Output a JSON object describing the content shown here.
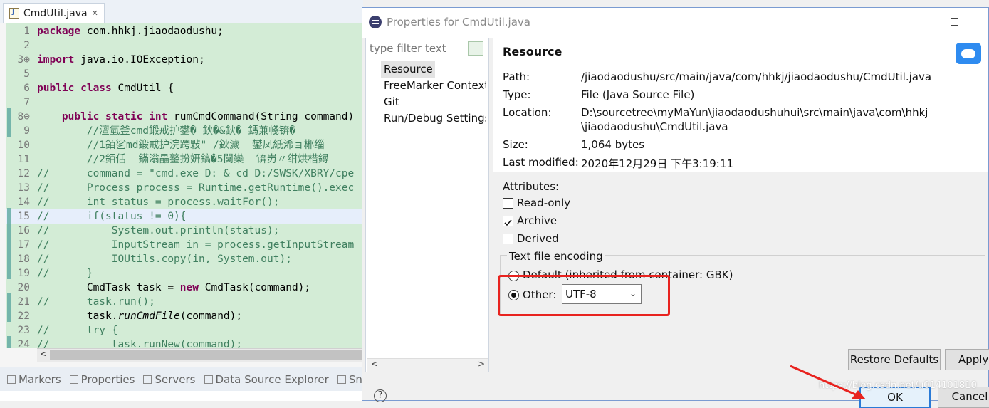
{
  "editor": {
    "tab_label": "CmdUtil.java",
    "tab_close": "✕",
    "lines": [
      {
        "n": "1",
        "marker": "",
        "parts": [
          [
            "kw",
            "package"
          ],
          [
            "",
            "&#32;com.hhkj.jiaodaodushu;"
          ]
        ]
      },
      {
        "n": "2",
        "marker": "",
        "parts": []
      },
      {
        "n": "3",
        "marker": "⊕",
        "parts": [
          [
            "kw",
            "import"
          ],
          [
            "",
            "&#32;java.io.IOException;"
          ]
        ]
      },
      {
        "n": "5",
        "marker": "",
        "parts": []
      },
      {
        "n": "6",
        "marker": "",
        "parts": [
          [
            "kw",
            "public class"
          ],
          [
            "",
            "&#32;CmdUtil {"
          ]
        ]
      },
      {
        "n": "7",
        "marker": "",
        "parts": []
      },
      {
        "n": "8",
        "marker": "⊖",
        "parts": [
          [
            "",
            "    "
          ],
          [
            "kw",
            "public static int"
          ],
          [
            "",
            "&#32;rumCmdCommand(String command)"
          ]
        ]
      },
      {
        "n": "9",
        "marker": "",
        "parts": [
          [
            "cm",
            "        //澶氫釜cmd鍛戒护鐢� 鈥�&鈥� 鎷兼帴锛�"
          ]
        ]
      },
      {
        "n": "10",
        "marker": "",
        "parts": [
          [
            "cm",
            "        //1銆乷md鍛戒护浣跨敤\" /鈥濊  鐢凤紙浠ョ郴缁"
          ]
        ]
      },
      {
        "n": "11",
        "marker": "",
        "parts": [
          [
            "cm",
            "        //2銆佸  鏋滃畾鐜扮姸鎬�5闅欒  锛岃〃绀烘棤鐞"
          ]
        ]
      },
      {
        "n": "12",
        "marker": "",
        "parts": [
          [
            "cm",
            "//      command = \"cmd.exe D: & cd D:/SWSK/XBRY/cpe"
          ]
        ]
      },
      {
        "n": "13",
        "marker": "",
        "parts": [
          [
            "cm",
            "//      Process process = Runtime.getRuntime().exec"
          ]
        ]
      },
      {
        "n": "14",
        "marker": "",
        "parts": [
          [
            "cm",
            "//      int status = process.waitFor();"
          ]
        ]
      },
      {
        "n": "15",
        "marker": "",
        "parts": [
          [
            "cm",
            "//      if(status != 0){"
          ]
        ]
      },
      {
        "n": "16",
        "marker": "",
        "parts": [
          [
            "cm",
            "//          System.out.println(status);"
          ]
        ]
      },
      {
        "n": "17",
        "marker": "",
        "parts": [
          [
            "cm",
            "//          InputStream in = process.getInputStream"
          ]
        ]
      },
      {
        "n": "18",
        "marker": "",
        "parts": [
          [
            "cm",
            "//          IOUtils.copy(in, System.out);"
          ]
        ]
      },
      {
        "n": "19",
        "marker": "",
        "parts": [
          [
            "cm",
            "//      }"
          ]
        ]
      },
      {
        "n": "20",
        "marker": "",
        "parts": [
          [
            "",
            "        CmdTask task = "
          ],
          [
            "kw",
            "new"
          ],
          [
            "",
            "&#32;CmdTask(command);"
          ]
        ]
      },
      {
        "n": "21",
        "marker": "",
        "parts": [
          [
            "cm",
            "//      task.run();"
          ]
        ]
      },
      {
        "n": "22",
        "marker": "",
        "parts": [
          [
            "",
            "        task."
          ],
          [
            "it",
            "runCmdFile"
          ],
          [
            "",
            "(command);"
          ]
        ]
      },
      {
        "n": "23",
        "marker": "",
        "parts": [
          [
            "cm",
            "//      try {"
          ]
        ]
      },
      {
        "n": "24",
        "marker": "",
        "parts": [
          [
            "cm",
            "//          task.runNew(command);"
          ]
        ]
      }
    ],
    "bottom_tabs": [
      "Markers",
      "Properties",
      "Servers",
      "Data Source Explorer",
      "Sn"
    ]
  },
  "dialog": {
    "title": "Properties for CmdUtil.java",
    "filter_placeholder": "type filter text",
    "nav_items": [
      "Resource",
      "FreeMarker Context",
      "Git",
      "Run/Debug Settings"
    ],
    "section_title": "Resource",
    "properties": [
      {
        "label": "Path:",
        "value": "/jiaodaodushu/src/main/java/com/hhkj/jiaodaodushu/CmdUtil.java"
      },
      {
        "label": "Type:",
        "value": "File  (Java Source File)"
      },
      {
        "label": "Location:",
        "value": "D:\\sourcetree\\myMaYun\\jiaodaodushuhui\\src\\main\\java\\com\\hhkj",
        "value2": "\\jiaodaodushu\\CmdUtil.java"
      },
      {
        "label": "Size:",
        "value": "1,064  bytes"
      },
      {
        "label": "Last modified:",
        "value": "2020年12月29日 下午3:19:11"
      }
    ],
    "attributes_label": "Attributes:",
    "attributes": [
      {
        "label": "Read-only",
        "checked": false
      },
      {
        "label": "Archive",
        "checked": true
      },
      {
        "label": "Derived",
        "checked": false
      }
    ],
    "encoding": {
      "legend": "Text file encoding",
      "default_label": "Default (inherited from container: GBK)",
      "other_label": "Other:",
      "selected": "UTF-8"
    },
    "buttons": {
      "restore_defaults": "Restore Defaults",
      "apply": "Apply",
      "ok": "OK",
      "cancel": "Cancel",
      "help": "?"
    },
    "watermark": "https://blog.csdn.net/u014101810",
    "highlight_color": "#e8231f"
  }
}
